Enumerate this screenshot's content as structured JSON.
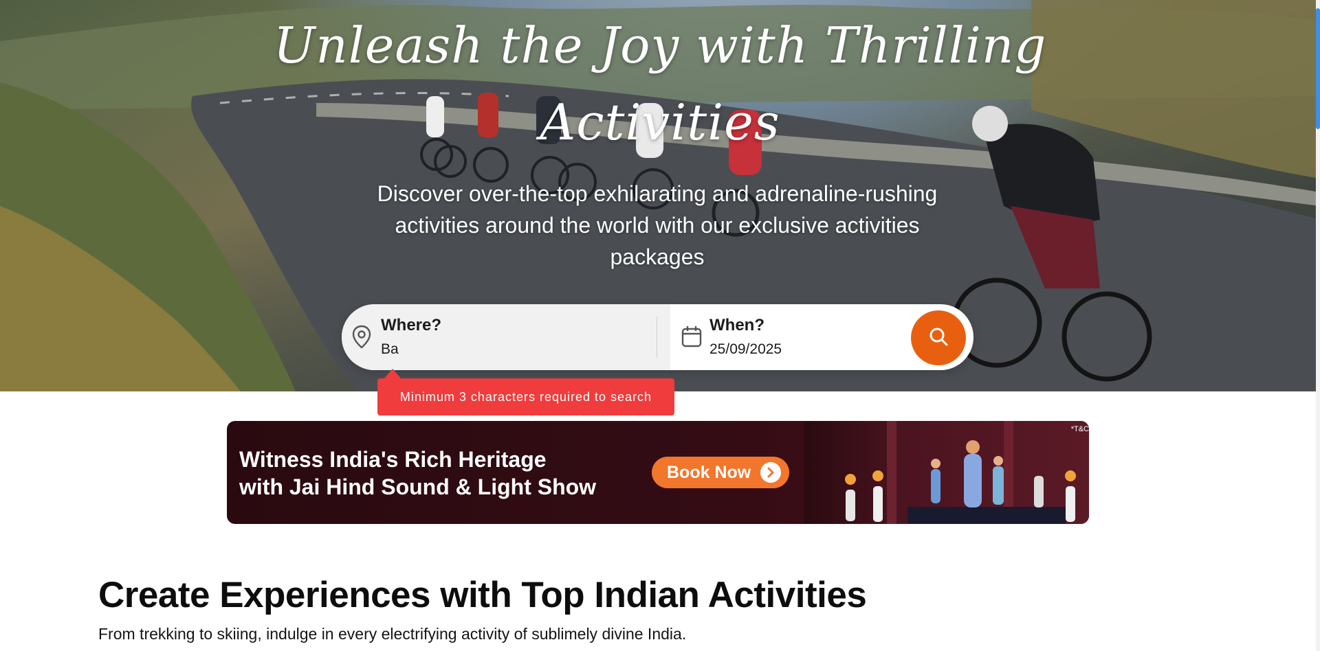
{
  "hero": {
    "title_line1": "Unleash the Joy with Thrilling",
    "title_line2": "Activities",
    "subtitle_line1": "Discover over-the-top exhilarating and adrenaline-rushing",
    "subtitle_line2": "activities around the world with our exclusive activities",
    "subtitle_line3": "packages"
  },
  "search": {
    "where_label": "Where?",
    "where_value": "Ba",
    "when_label": "When?",
    "when_value": "25/09/2025",
    "where_icon": "location-pin-icon",
    "when_icon": "calendar-icon",
    "button_icon": "search-icon",
    "error_message": "Minimum 3 characters required to search"
  },
  "banner": {
    "line1": "Witness India's Rich Heritage",
    "line2": "with Jai Hind Sound & Light Show",
    "button_label": "Book Now",
    "terms": "*T&C"
  },
  "section": {
    "title": "Create Experiences with Top Indian Activities",
    "subtitle": "From trekking to skiing, indulge in every electrifying activity of sublimely divine India."
  },
  "colors": {
    "accent": "#e8600f",
    "error": "#f03c3c",
    "banner_bg": "#2a0a10",
    "scroll_thumb": "#3f8ee8"
  }
}
